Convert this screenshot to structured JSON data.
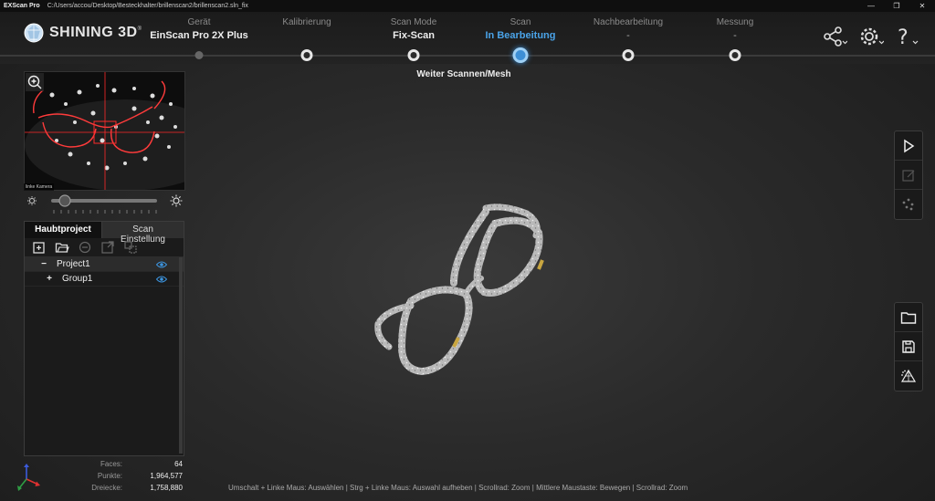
{
  "window": {
    "app_title": "EXScan Pro",
    "path": "C:/Users/accou/Desktop/Besteckhalter/brillenscan2/brillenscan2.sln_fix",
    "controls": [
      "—",
      "❐",
      "✕"
    ]
  },
  "brand": {
    "name": "SHINING 3D"
  },
  "steps": [
    {
      "label": "Gerät",
      "value": "EinScan Pro 2X Plus",
      "state": "done"
    },
    {
      "label": "Kalibrierung",
      "value": "",
      "state": "normal"
    },
    {
      "label": "Scan Mode",
      "value": "Fix-Scan",
      "state": "normal"
    },
    {
      "label": "Scan",
      "value": "In Bearbeitung",
      "state": "active"
    },
    {
      "label": "Nachbearbeitung",
      "value": "-",
      "state": "normal"
    },
    {
      "label": "Messung",
      "value": "-",
      "state": "normal"
    }
  ],
  "active_step_caption": "Weiter Scannen/Mesh",
  "preview": {
    "camera_label": "linke Kamera"
  },
  "panel": {
    "tabs": [
      "Haubtproject",
      "Scan Einstellung"
    ],
    "tree": [
      {
        "toggle": "−",
        "label": "Project1"
      },
      {
        "toggle": "+",
        "label": "Group1"
      }
    ]
  },
  "stats": [
    {
      "key": "Faces:",
      "value": "64"
    },
    {
      "key": "Punkte:",
      "value": "1,964,577"
    },
    {
      "key": "Dreiecke:",
      "value": "1,758,880"
    }
  ],
  "status_bar": "Umschalt + Linke Maus: Auswählen  | Strg + Linke Maus: Auswahl aufheben | Scrollrad: Zoom | Mittlere Maustaste: Bewegen | Scrollrad: Zoom",
  "colors": {
    "accent": "#3d8fd6",
    "active_text": "#4aa3e8",
    "background": "#2a2a2a"
  },
  "icons": {
    "header": [
      "share-icon",
      "gear-icon",
      "help-icon"
    ],
    "side_top": [
      "play-icon",
      "edit-disabled-icon",
      "points-icon"
    ],
    "side_bottom": [
      "folder-icon",
      "save-icon",
      "mesh-icon"
    ]
  }
}
